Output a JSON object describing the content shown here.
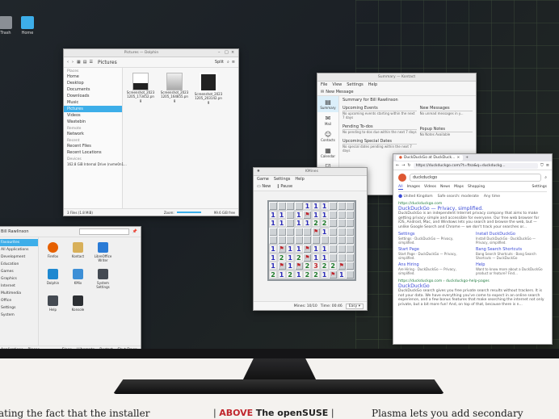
{
  "desktop": {
    "icons": [
      {
        "label": "Trash",
        "icon": "trash-icon"
      },
      {
        "label": "Home",
        "icon": "home-folder-icon"
      }
    ]
  },
  "dolphin": {
    "title": "Pictures — Dolphin",
    "path": "Pictures",
    "split_label": "Split",
    "sidebar": {
      "places_head": "Places",
      "places": [
        "Home",
        "Desktop",
        "Documents",
        "Downloads",
        "Music",
        "Pictures",
        "Videos",
        "Wastebin"
      ],
      "remote_head": "Remote",
      "remote": [
        "Network"
      ],
      "recent_head": "Recent",
      "recent": [
        "Recent Files",
        "Recent Locations"
      ],
      "devices_head": "Devices",
      "devices": [
        "162.8 GiB Internal Drive (nvme0n1..."
      ]
    },
    "files": [
      {
        "name": "Screenshot_20231205_173452.png"
      },
      {
        "name": "Screenshot_20231205_164855.png"
      },
      {
        "name": "Screenshot_20231205_203142.png"
      }
    ],
    "status": "3 Files (1.8 MiB)",
    "zoom_label": "Zoom:",
    "free_space": "99.6 GiB free"
  },
  "kontact": {
    "title": "Summary — Kontact",
    "menu": [
      "File",
      "View",
      "Settings",
      "Help"
    ],
    "new_message": "New Message",
    "summary_header": "Summary for Bill Rawlinson",
    "nav": [
      "Summary",
      "Mail",
      "Contacts",
      "Calendar",
      "To-do List"
    ],
    "upcoming_events": {
      "title": "Upcoming Events",
      "body": "No upcoming events starting within the next 7 days"
    },
    "pending_todos": {
      "title": "Pending To-dos",
      "body": "No pending to-dos due within the next 7 days"
    },
    "special_dates": {
      "title": "Upcoming Special Dates",
      "body": "No special dates pending within the next 7 days"
    },
    "new_messages": {
      "title": "New Messages",
      "body": "No unread messages in y..."
    },
    "popup_notes": {
      "title": "Popup Notes",
      "body": "No Notes Available"
    }
  },
  "kmines": {
    "title": "KMines",
    "menu": [
      "Game",
      "Settings",
      "Help"
    ],
    "new_label": "New",
    "pause_label": "Pause",
    "status_mines": "Mines: 10/10",
    "status_time": "Time: 00:46",
    "difficulty": "Easy",
    "grid": [
      "CCCC111CCC",
      "11C1F11CCC",
      "11C1122CCC",
      "CCCCCF1CCC",
      "CCCCCCCCCC",
      "1F11F11CCC",
      "1212F11CCC",
      "1F1F2322FC",
      "2121221F1C"
    ]
  },
  "browser": {
    "tab_title": "DuckDuckGo at DuckDuck...",
    "url": "https://duckduckgo.com/?t=ftsa&q=duckduckg...",
    "query": "duckduckgo",
    "tabs": [
      "All",
      "Images",
      "Videos",
      "News",
      "Maps",
      "Shopping"
    ],
    "settings_label": "Settings",
    "region": "United Kingdom",
    "safe_search": "Safe search: moderate",
    "any_time": "Any time",
    "result1": {
      "url": "https://duckduckgo.com",
      "title": "DuckDuckGo — Privacy, simplified.",
      "desc": "DuckDuckGo is an independent Internet privacy company that aims to make getting privacy simple and accessible for everyone. Our free web browser for iOS, Android, Mac, and Windows lets you search and browse the web, but — unlike Google Search and Chrome — we don't track your searches or..."
    },
    "sitelinks": [
      {
        "title": "Settings",
        "desc": "Settings · DuckDuckGo — Privacy, simplified."
      },
      {
        "title": "Install DuckDuckGo",
        "desc": "Install DuckDuckGo · DuckDuckGo — Privacy, simplified."
      },
      {
        "title": "Start Page",
        "desc": "Start Page · DuckDuckGo — Privacy, simplified."
      },
      {
        "title": "Bang Search Shortcuts",
        "desc": "Bang Search Shortcuts · Bang Search Shortcuts — DuckDuckGo"
      },
      {
        "title": "Ans Hiring",
        "desc": "Are Hiring · DuckDuckGo — Privacy, simplified."
      },
      {
        "title": "Help",
        "desc": "Want to know more about a DuckDuckGo product or feature? Find..."
      }
    ],
    "result2": {
      "url": "https://duckduckgo.com › duckduckgo-help-pages",
      "title": "DuckDuckGo",
      "desc": "DuckDuckGo search gives you free private search results without trackers. It is not your data. We have everything you've come to expect in an online search experience, and a few bonus features that make searching the internet not only private, but a bit more fun! And, on top of that, because there is n..."
    }
  },
  "launcher": {
    "user": "Bill Rawlinson",
    "categories": [
      "Favourites",
      "All Applications",
      "Development",
      "Education",
      "Games",
      "Graphics",
      "Internet",
      "Multimedia",
      "Office",
      "Settings",
      "System"
    ],
    "apps": [
      {
        "label": "Firefox",
        "icon": "firefox-icon",
        "color": "#e66000"
      },
      {
        "label": "Kontact",
        "icon": "kontact-icon",
        "color": "#d8b05a"
      },
      {
        "label": "LibreOffice Writer",
        "icon": "writer-icon",
        "color": "#2a7bd6"
      },
      {
        "label": "Dolphin",
        "icon": "dolphin-icon",
        "color": "#1e88d0"
      },
      {
        "label": "KMix",
        "icon": "kmix-icon",
        "color": "#3d8fd6"
      },
      {
        "label": "System Settings",
        "icon": "settings-icon",
        "color": "#444a52"
      },
      {
        "label": "Help",
        "icon": "help-icon",
        "color": "#444a52"
      },
      {
        "label": "Konsole",
        "icon": "konsole-icon",
        "color": "#2c2f33"
      }
    ],
    "footer_tabs": [
      "Applications",
      "Places"
    ],
    "power": [
      "Sleep",
      "Hibernate",
      "Restart",
      "Shut Down"
    ]
  },
  "magazine": {
    "left_text": "ating the fact that the installer",
    "caption_label": "ABOVE",
    "caption_text": "The openSUSE",
    "right_text": "Plasma lets you add secondary"
  }
}
